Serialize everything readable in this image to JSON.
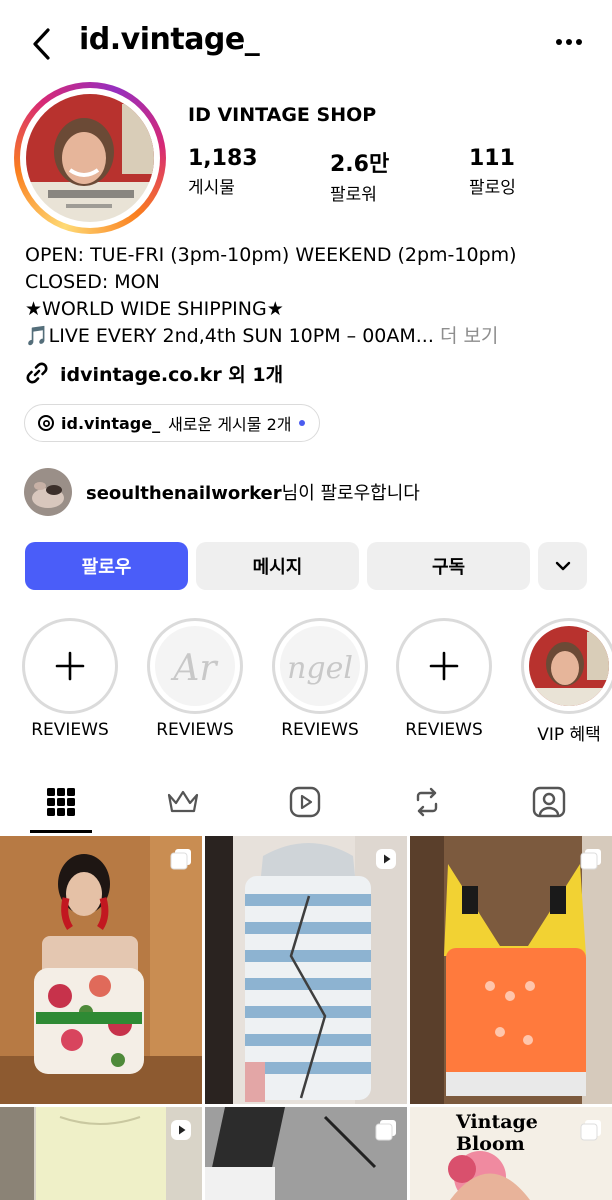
{
  "header": {
    "username": "id.vintage_",
    "back_icon": "chevron-left-icon",
    "more_icon": "ellipsis-icon"
  },
  "profile": {
    "display_name": "ID VINTAGE SHOP",
    "story_ring_colors": [
      "#feda75",
      "#fa7e1e",
      "#d62976",
      "#962fbf"
    ],
    "stats": [
      {
        "value": "1,183",
        "label": "게시물"
      },
      {
        "value": "2.6만",
        "label": "팔로워"
      },
      {
        "value": "111",
        "label": "팔로잉"
      }
    ],
    "bio_lines": [
      "OPEN: TUE-FRI (3pm-10pm) WEEKEND (2pm-10pm)",
      "CLOSED: MON",
      "★WORLD WIDE SHIPPING★",
      "🎵LIVE EVERY 2nd,4th SUN 10PM – 00AM..."
    ],
    "bio_more": "더 보기",
    "link_text": "idvintage.co.kr 외 1개"
  },
  "threads": {
    "name": "id.vintage_",
    "new_posts": "새로운 게시물 2개",
    "dot_color": "#4a5cf0"
  },
  "followed_by": {
    "name": "seoulthenailworker",
    "suffix": "님이 팔로우합니다"
  },
  "actions": {
    "follow": "팔로우",
    "message": "메시지",
    "subscribe": "구독",
    "accent_color": "#4a5df9"
  },
  "highlights": [
    {
      "label": "REVIEWS",
      "kind": "plus"
    },
    {
      "label": "REVIEWS",
      "kind": "script",
      "script_text": "Ar"
    },
    {
      "label": "REVIEWS",
      "kind": "script",
      "script_text": "ngel"
    },
    {
      "label": "REVIEWS",
      "kind": "plus"
    },
    {
      "label": "VIP 혜택",
      "kind": "photo"
    }
  ],
  "tabs": [
    "grid-icon",
    "crown-icon",
    "reels-icon",
    "reposts-icon",
    "tagged-icon"
  ],
  "grid": {
    "overlay_text": "Vintage Bloom"
  }
}
